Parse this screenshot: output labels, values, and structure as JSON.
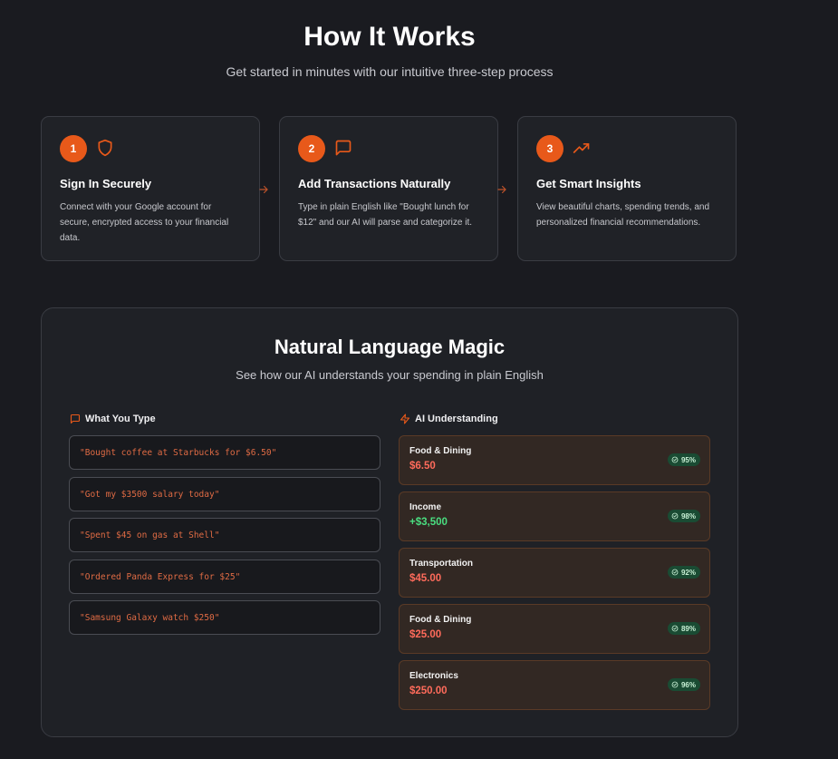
{
  "hero": {
    "title": "How It Works",
    "subtitle": "Get started in minutes with our intuitive three-step process"
  },
  "steps": [
    {
      "number": "1",
      "icon": "shield-icon",
      "title": "Sign In Securely",
      "description": "Connect with your Google account for secure, encrypted access to your financial data."
    },
    {
      "number": "2",
      "icon": "message-square-icon",
      "title": "Add Transactions Naturally",
      "description": "Type in plain English like \"Bought lunch for $12\" and our AI will parse and categorize it."
    },
    {
      "number": "3",
      "icon": "trending-up-icon",
      "title": "Get Smart Insights",
      "description": "View beautiful charts, spending trends, and personalized financial recommendations."
    }
  ],
  "magic": {
    "title": "Natural Language Magic",
    "subtitle": "See how our AI understands your spending in plain English",
    "left_heading": "What You Type",
    "right_heading": "AI Understanding",
    "inputs": [
      "\"Bought coffee at Starbucks for $6.50\"",
      "\"Got my $3500 salary today\"",
      "\"Spent $45 on gas at Shell\"",
      "\"Ordered Panda Express for $25\"",
      "\"Samsung Galaxy watch $250\""
    ],
    "results": [
      {
        "category": "Food & Dining",
        "amount": "$6.50",
        "confidence": "95%"
      },
      {
        "category": "Income",
        "amount": "+$3,500",
        "confidence": "98%"
      },
      {
        "category": "Transportation",
        "amount": "$45.00",
        "confidence": "92%"
      },
      {
        "category": "Food & Dining",
        "amount": "$25.00",
        "confidence": "89%"
      },
      {
        "category": "Electronics",
        "amount": "$250.00",
        "confidence": "96%"
      }
    ]
  },
  "colors": {
    "accent": "#e8591a",
    "expense": "#ff6b5b",
    "income": "#4ade80",
    "badge_bg": "#1a4b33"
  }
}
